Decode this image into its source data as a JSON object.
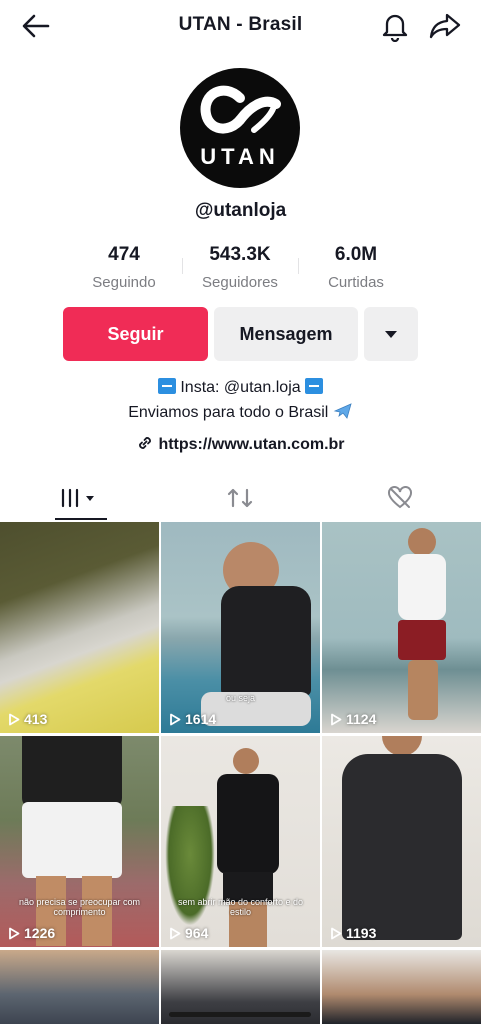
{
  "header": {
    "title": "UTAN - Brasil",
    "back_icon": "back-arrow-icon",
    "bell_icon": "bell-icon",
    "share_icon": "share-icon"
  },
  "profile": {
    "avatar_text": "UTAN",
    "username": "@utanloja"
  },
  "stats": [
    {
      "value": "474",
      "label": "Seguindo"
    },
    {
      "value": "543.3K",
      "label": "Seguidores"
    },
    {
      "value": "6.0M",
      "label": "Curtidas"
    }
  ],
  "actions": {
    "follow": "Seguir",
    "message": "Mensagem",
    "more_icon": "caret-down-icon"
  },
  "bio": {
    "line1": "Insta: @utan.loja",
    "line2": "Enviamos para todo o Brasil"
  },
  "link": "https://www.utan.com.br",
  "tabs": [
    "grid-icon",
    "repost-icon",
    "liked-hidden-icon"
  ],
  "videos": [
    {
      "views": "413",
      "caption": ""
    },
    {
      "views": "1614",
      "caption": "ou seja"
    },
    {
      "views": "1124",
      "caption": ""
    },
    {
      "views": "1226",
      "caption": "não precisa se preocupar com comprimento"
    },
    {
      "views": "964",
      "caption": "sem abrir mão do conforto e do estilo"
    },
    {
      "views": "1193",
      "caption": ""
    }
  ],
  "colors": {
    "follow": "#f02c56",
    "secondary_btn": "#efeff0",
    "text": "#161823",
    "muted": "#7c7d82"
  }
}
